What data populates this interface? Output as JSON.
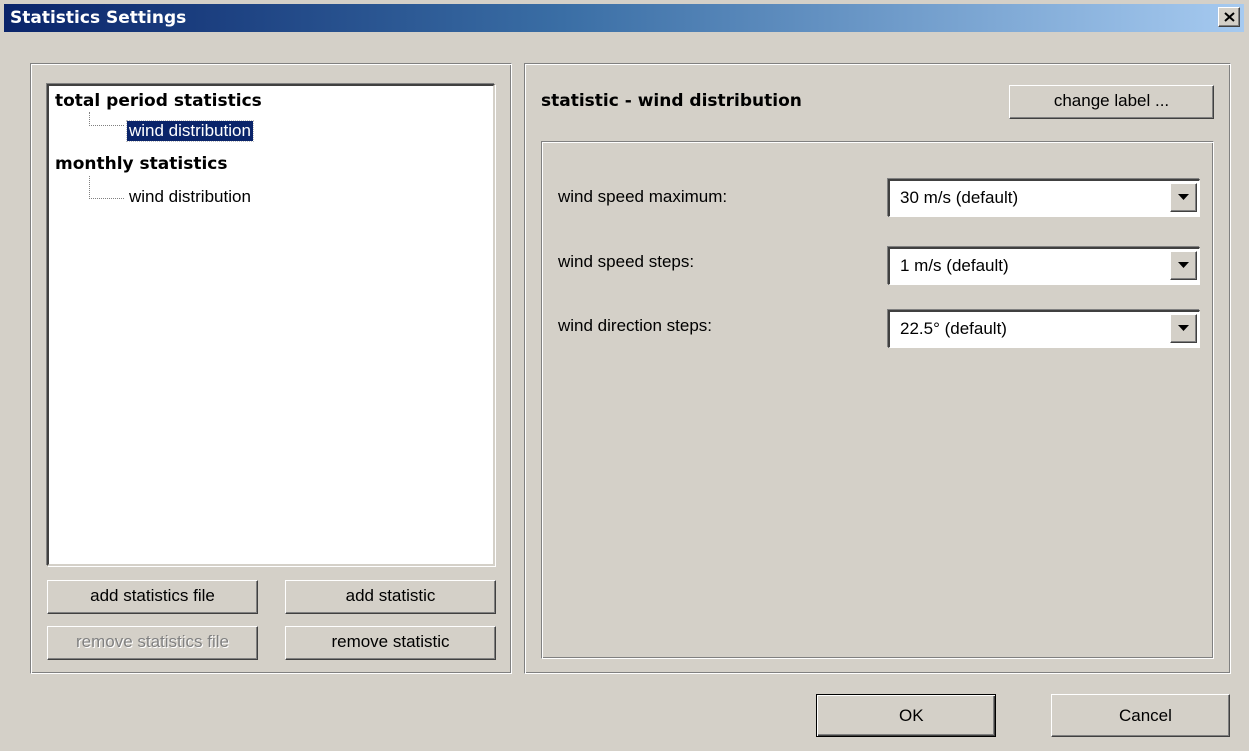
{
  "window": {
    "title": "Statistics Settings"
  },
  "tree": {
    "groups": [
      {
        "label": "total period statistics",
        "children": [
          {
            "label": "wind distribution",
            "selected": true
          }
        ]
      },
      {
        "label": "monthly statistics",
        "children": [
          {
            "label": "wind distribution",
            "selected": false
          }
        ]
      }
    ]
  },
  "left_buttons": {
    "add_file": "add statistics file",
    "add_statistic": "add statistic",
    "remove_file": "remove statistics file",
    "remove_statistic": "remove statistic"
  },
  "panel": {
    "title": "statistic - wind distribution",
    "change_label": "change label ...",
    "fields": [
      {
        "label": "wind speed maximum:",
        "value": "30 m/s  (default)"
      },
      {
        "label": "wind speed steps:",
        "value": "1 m/s  (default)"
      },
      {
        "label": "wind direction steps:",
        "value": "22.5°  (default)"
      }
    ]
  },
  "footer": {
    "ok": "OK",
    "cancel": "Cancel"
  },
  "colors": {
    "title_gradient_start": "#0a246a",
    "title_gradient_end": "#a6caf0",
    "face": "#d4d0c8",
    "selection": "#0a246a"
  }
}
